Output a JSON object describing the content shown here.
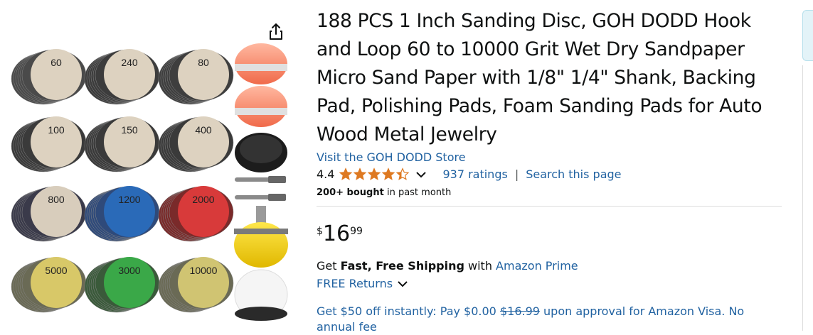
{
  "product": {
    "title": "188 PCS 1 Inch Sanding Disc, GOH DODD Hook and Loop 60 to 10000 Grit Wet Dry Sandpaper Micro Sand Paper with 1/8\" 1/4\" Shank, Backing Pad, Polishing Pads, Foam Sanding Pads for Auto Wood Metal Jewelry",
    "store_link": "Visit the GOH DODD Store",
    "rating_value": "4.4",
    "rating_stars": 4.4,
    "ratings_count": "937 ratings",
    "search_page": "Search this page",
    "bought_bold": "200+ bought",
    "bought_rest": " in past month"
  },
  "price": {
    "currency": "$",
    "whole": "16",
    "fraction": "99"
  },
  "shipping": {
    "prefix": "Get ",
    "bold": "Fast, Free Shipping",
    "middle": " with ",
    "link": "Amazon Prime",
    "returns": "FREE Returns"
  },
  "promo": {
    "part1": "Get $50 off instantly: Pay $0.00 ",
    "strike": "$16.99",
    "part2": " upon approval for Amazon Visa. No annual fee"
  },
  "image": {
    "grit_labels": [
      "60",
      "240",
      "80",
      "100",
      "150",
      "400",
      "800",
      "1200",
      "2000",
      "5000",
      "3000",
      "10000"
    ]
  },
  "colors": {
    "link": "#2162a1",
    "star": "#de7921",
    "text": "#0f1111"
  },
  "icons": {
    "share": "share-icon",
    "chevron": "chevron-down-icon",
    "star": "star-icon"
  }
}
